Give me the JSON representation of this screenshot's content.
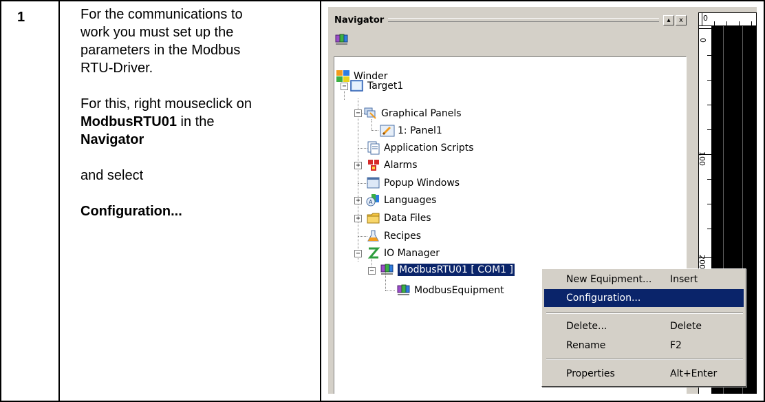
{
  "step": {
    "number": "1",
    "lines": [
      "For the communications to",
      "work you must set up the",
      "parameters in the  Modbus",
      "RTU-Driver."
    ],
    "para2_line1": "For this, right mouseclick on",
    "para2_bold1": "ModbusRTU01",
    "para2_line2_rest": " in the",
    "para2_bold2": "Navigator",
    "select_text": " and select",
    "configuration": "Configuration..."
  },
  "navigator": {
    "title": "Navigator",
    "pin_btn": "▴",
    "close_btn": "x",
    "tree": {
      "root": "Winder",
      "target": "Target1",
      "graphical_panels": "Graphical Panels",
      "panel1": "1: Panel1",
      "application_scripts": "Application Scripts",
      "alarms": "Alarms",
      "popup_windows": "Popup Windows",
      "languages": "Languages",
      "data_files": "Data Files",
      "recipes": "Recipes",
      "io_manager": "IO Manager",
      "modbus_rtu": "ModbusRTU01 [ COM1 ]",
      "modbus_equipment": "ModbusEquipment"
    },
    "expander_minus": "−",
    "expander_plus": "+"
  },
  "ruler": {
    "top_zero": "0",
    "left_zero": "0",
    "left_100": "100",
    "left_200": "200"
  },
  "context_menu": {
    "items": [
      {
        "label": "New Equipment...",
        "shortcut": "Insert"
      },
      {
        "label": "Configuration...",
        "shortcut": ""
      },
      {
        "label": "Delete...",
        "shortcut": "Delete"
      },
      {
        "label": "Rename",
        "shortcut": "F2"
      },
      {
        "label": "Properties",
        "shortcut": "Alt+Enter"
      }
    ],
    "highlight_color": "#0a246a"
  }
}
